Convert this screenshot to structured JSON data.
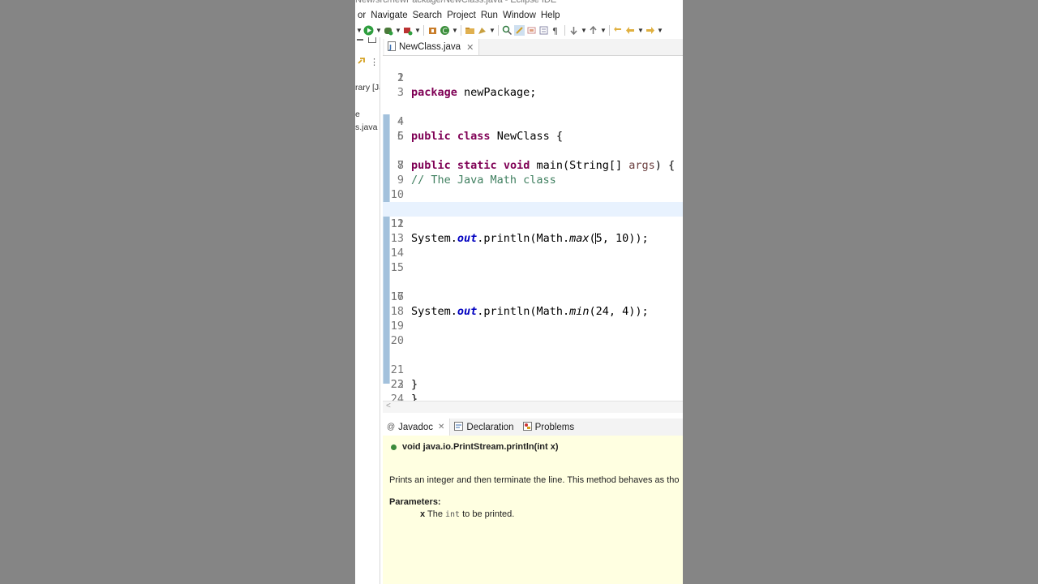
{
  "window": {
    "title": "New/src/newPackage/NewClass.java - Eclipse IDE"
  },
  "menu": {
    "items": [
      "or",
      "Navigate",
      "Search",
      "Project",
      "Run",
      "Window",
      "Help"
    ]
  },
  "left_panel": {
    "labels": [
      "rary [Ja",
      "e",
      "s.java"
    ]
  },
  "editor": {
    "tab_label": "NewClass.java",
    "lines": [
      {
        "num": "1",
        "text": "package newPackage;"
      },
      {
        "num": "2",
        "text": ""
      },
      {
        "num": "3",
        "text": ""
      },
      {
        "num": "4",
        "text": "public class NewClass {"
      },
      {
        "num": "5",
        "text": "public static void main(String[] args) {"
      },
      {
        "num": "6",
        "text": ""
      },
      {
        "num": "7",
        "text": "// The Java Math class"
      },
      {
        "num": "8",
        "text": ""
      },
      {
        "num": "9",
        "text": ""
      },
      {
        "num": "10",
        "text": ""
      },
      {
        "num": "11",
        "text": "System.out.println(Math.max(5, 10));"
      },
      {
        "num": "12",
        "text": ""
      },
      {
        "num": "13",
        "text": ""
      },
      {
        "num": "14",
        "text": ""
      },
      {
        "num": "15",
        "text": ""
      },
      {
        "num": "16",
        "text": "System.out.println(Math.min(24, 4));"
      },
      {
        "num": "17",
        "text": ""
      },
      {
        "num": "18",
        "text": ""
      },
      {
        "num": "19",
        "text": ""
      },
      {
        "num": "20",
        "text": ""
      },
      {
        "num": "21",
        "text": "}"
      },
      {
        "num": "22",
        "text": "}"
      },
      {
        "num": "23",
        "text": ""
      },
      {
        "num": "24",
        "text": ""
      }
    ],
    "tokens": {
      "package": "package",
      "newPackage": " newPackage;",
      "public": "public",
      "class": "class",
      "newclass_decl": " NewClass {",
      "static": "static",
      "void": "void",
      "main_sig": " main(String[] ",
      "args": "args",
      "main_end": ") {",
      "comment": "// The Java Math class",
      "system": "System.",
      "out": "out",
      "println_math": ".println(Math.",
      "max": "max",
      "max_args_a": "(",
      "max_args_b": "5, 10));",
      "min": "min",
      "min_args": "(24, 4));",
      "brace": "}"
    }
  },
  "bottom_panel": {
    "tabs": [
      {
        "label": "Javadoc",
        "icon": "at-icon"
      },
      {
        "label": "Declaration",
        "icon": "declaration-icon"
      },
      {
        "label": "Problems",
        "icon": "problems-icon"
      }
    ],
    "javadoc": {
      "signature": "void java.io.PrintStream.println(int x)",
      "description": "Prints an integer and then terminate the line. This method behaves as tho",
      "params_heading": "Parameters:",
      "param_name": "x",
      "param_text_a": " The ",
      "param_code": "int",
      "param_text_b": " to be printed."
    }
  },
  "colors": {
    "keyword": "#7f0055",
    "comment": "#3f7f5f",
    "field": "#0000c0",
    "javadoc_bg": "#ffffe1",
    "background": "#858585"
  }
}
